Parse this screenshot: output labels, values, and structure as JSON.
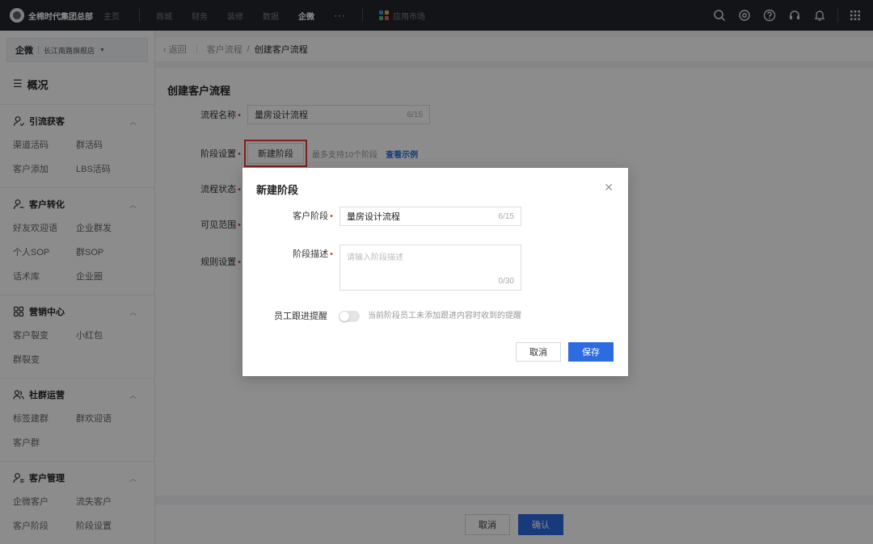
{
  "topbar": {
    "brand": "全棉时代集团总部",
    "nav": [
      "主页",
      "商城",
      "财务",
      "装修",
      "数据",
      "企微"
    ],
    "active_nav": "企微",
    "more": "···",
    "app_market": "应用市场",
    "icons": [
      "search-icon",
      "settings-icon",
      "help-icon",
      "headset-icon",
      "bell-icon",
      "grid-menu-icon"
    ]
  },
  "sidebar": {
    "org_label": "企微",
    "org_store": "长江南路旗舰店",
    "overview": "概况",
    "groups": [
      {
        "title": "引流获客",
        "icon": "user-icon",
        "items": [
          "渠道活码",
          "群活码",
          "客户添加",
          "LBS活码"
        ]
      },
      {
        "title": "客户转化",
        "icon": "user-icon",
        "items": [
          "好友欢迎语",
          "企业群发",
          "个人SOP",
          "群SOP",
          "话术库",
          "企业圈"
        ]
      },
      {
        "title": "营销中心",
        "icon": "apps-icon",
        "items": [
          "客户裂变",
          "小红包",
          "群裂变"
        ]
      },
      {
        "title": "社群运营",
        "icon": "users-icon",
        "items": [
          "标签建群",
          "群欢迎语",
          "客户群"
        ]
      },
      {
        "title": "客户管理",
        "icon": "user-list-icon",
        "items": [
          "企微客户",
          "流失客户",
          "客户阶段",
          "阶段设置"
        ]
      }
    ]
  },
  "breadcrumb": {
    "back": "返回",
    "parent": "客户流程",
    "separator": "/",
    "current": "创建客户流程"
  },
  "form": {
    "title": "创建客户流程",
    "name_label": "流程名称",
    "name_value": "量房设计流程",
    "name_count": "6/15",
    "stage_label": "阶段设置",
    "new_stage_button": "新建阶段",
    "stage_hint": "最多支持10个阶段",
    "example_link": "查看示例",
    "status_label": "流程状态",
    "scope_label": "可见范围",
    "rule_label": "规则设置"
  },
  "footer": {
    "cancel": "取消",
    "confirm": "确认"
  },
  "modal": {
    "title": "新建阶段",
    "stage_label": "客户阶段",
    "stage_value": "量房设计流程",
    "stage_count": "6/15",
    "desc_label": "阶段描述",
    "desc_placeholder": "请输入阶段描述",
    "desc_count": "0/30",
    "reminder_label": "员工跟进提醒",
    "reminder_on": false,
    "reminder_hint": "当前阶段员工未添加跟进内容时收到的提醒",
    "cancel": "取消",
    "save": "保存"
  },
  "colors": {
    "primary": "#2c6be0",
    "required": "#e0443b",
    "highlight": "#e53935",
    "topbar": "#24262b"
  }
}
